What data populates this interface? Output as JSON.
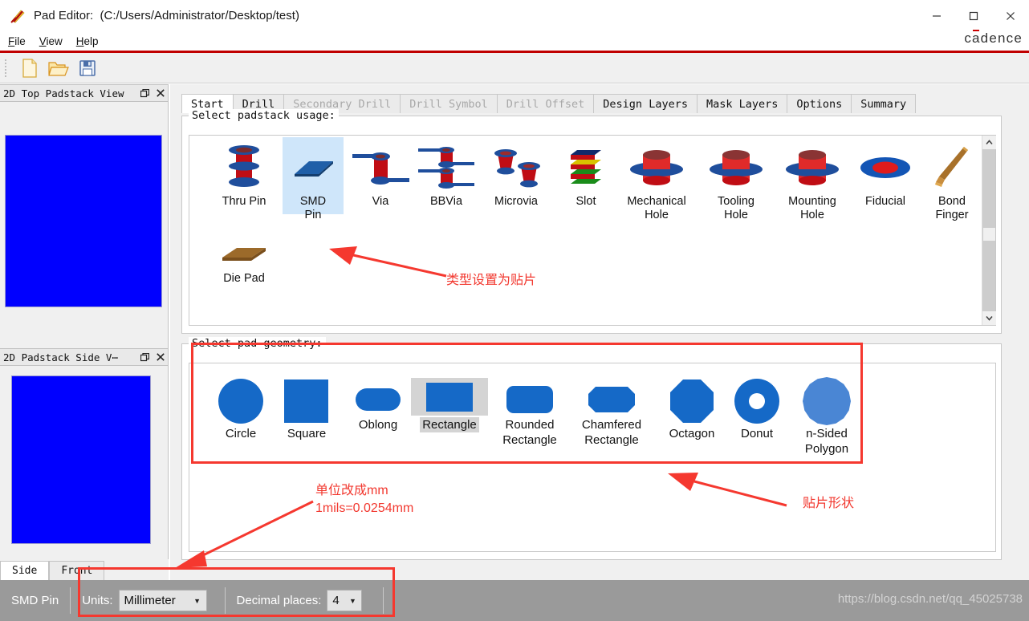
{
  "window": {
    "app_icon": "pad-editor-icon",
    "title": "Pad Editor:  (C:/Users/Administrator/Desktop/test)",
    "minimize": "—",
    "maximize": "☐",
    "close": "✕",
    "brand_before": "c",
    "brand_a": "a",
    "brand_after": "dence"
  },
  "menu": {
    "items": [
      "File",
      "View",
      "Help"
    ]
  },
  "toolbar": {
    "items": [
      "new-file-icon",
      "open-folder-icon",
      "save-icon"
    ]
  },
  "left_panels": [
    {
      "title": "2D Top Padstack View",
      "float": "❐",
      "close": "✕"
    },
    {
      "title": "2D Padstack Side V⋯",
      "float": "❐",
      "close": "✕"
    }
  ],
  "side_tabs": [
    {
      "label": "Side",
      "active": true
    },
    {
      "label": "Front",
      "active": false
    }
  ],
  "tabs": [
    {
      "label": "Start",
      "state": "active"
    },
    {
      "label": "Drill",
      "state": "normal"
    },
    {
      "label": "Secondary Drill",
      "state": "disabled"
    },
    {
      "label": "Drill Symbol",
      "state": "disabled"
    },
    {
      "label": "Drill Offset",
      "state": "disabled"
    },
    {
      "label": "Design Layers",
      "state": "normal"
    },
    {
      "label": "Mask Layers",
      "state": "normal"
    },
    {
      "label": "Options",
      "state": "normal"
    },
    {
      "label": "Summary",
      "state": "normal"
    }
  ],
  "usage_group": {
    "legend": "Select padstack usage:",
    "items": [
      {
        "label": "Thru Pin",
        "icon": "thru-pin-icon",
        "selected": false
      },
      {
        "label": "SMD\nPin",
        "icon": "smd-pin-icon",
        "selected": true
      },
      {
        "label": "Via",
        "icon": "via-icon",
        "selected": false
      },
      {
        "label": "BBVia",
        "icon": "bbvia-icon",
        "selected": false
      },
      {
        "label": "Microvia",
        "icon": "microvia-icon",
        "selected": false
      },
      {
        "label": "Slot",
        "icon": "slot-icon",
        "selected": false
      },
      {
        "label": "Mechanical\nHole",
        "icon": "mechanical-hole-icon",
        "selected": false
      },
      {
        "label": "Tooling\nHole",
        "icon": "tooling-hole-icon",
        "selected": false
      },
      {
        "label": "Mounting\nHole",
        "icon": "mounting-hole-icon",
        "selected": false
      },
      {
        "label": "Fiducial",
        "icon": "fiducial-icon",
        "selected": false
      },
      {
        "label": "Bond\nFinger",
        "icon": "bond-finger-icon",
        "selected": false
      },
      {
        "label": "Die Pad",
        "icon": "die-pad-icon",
        "selected": false
      }
    ]
  },
  "geometry_group": {
    "legend": "Select pad geometry:",
    "items": [
      {
        "label": "Circle",
        "icon": "circle-shape-icon",
        "selected": false
      },
      {
        "label": "Square",
        "icon": "square-shape-icon",
        "selected": false
      },
      {
        "label": "Oblong",
        "icon": "oblong-shape-icon",
        "selected": false
      },
      {
        "label": "Rectangle",
        "icon": "rectangle-shape-icon",
        "selected": true
      },
      {
        "label": "Rounded\nRectangle",
        "icon": "rounded-rectangle-shape-icon",
        "selected": false
      },
      {
        "label": "Chamfered\nRectangle",
        "icon": "chamfered-rectangle-shape-icon",
        "selected": false
      },
      {
        "label": "Octagon",
        "icon": "octagon-shape-icon",
        "selected": false
      },
      {
        "label": "Donut",
        "icon": "donut-shape-icon",
        "selected": false
      },
      {
        "label": "n-Sided\nPolygon",
        "icon": "n-sided-polygon-shape-icon",
        "selected": false
      }
    ]
  },
  "status": {
    "mode": "SMD Pin",
    "units_label": "Units:",
    "units_value": "Millimeter",
    "decimal_label": "Decimal places:",
    "decimal_value": "4",
    "dropdown_arrow": "▼"
  },
  "watermark": "https://blog.csdn.net/qq_45025738",
  "annotations": [
    {
      "name": "usage-note",
      "text": "类型设置为贴片"
    },
    {
      "name": "units-note",
      "text": "单位改成mm\n1mils=0.0254mm"
    },
    {
      "name": "geometry-note",
      "text": "贴片形状"
    }
  ],
  "colors": {
    "annotation_red": "#f5382f",
    "pad_blue": "#0000ff",
    "shape_blue": "#1569c7",
    "brand_red": "#cc0000",
    "selection_blue": "#cfe6fa",
    "statusbar_gray": "#9a9a9a"
  }
}
